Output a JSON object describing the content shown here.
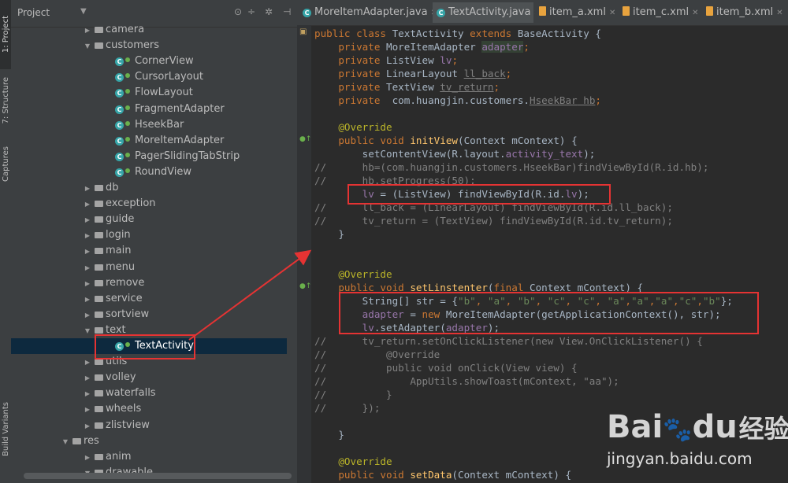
{
  "tool_window_strip": {
    "tabs": [
      "1: Project",
      "7: Structure",
      "Captures",
      "Build Variants"
    ]
  },
  "project_panel": {
    "title": "Project",
    "tree": [
      {
        "label": "camera",
        "kind": "folder",
        "depth": 1,
        "expanded": false
      },
      {
        "label": "customers",
        "kind": "folder",
        "depth": 1,
        "expanded": true
      },
      {
        "label": "CornerView",
        "kind": "class",
        "depth": 2
      },
      {
        "label": "CursorLayout",
        "kind": "class",
        "depth": 2
      },
      {
        "label": "FlowLayout",
        "kind": "class",
        "depth": 2
      },
      {
        "label": "FragmentAdapter",
        "kind": "class",
        "depth": 2
      },
      {
        "label": "HseekBar",
        "kind": "class",
        "depth": 2
      },
      {
        "label": "MoreItemAdapter",
        "kind": "class",
        "depth": 2
      },
      {
        "label": "PagerSlidingTabStrip",
        "kind": "class",
        "depth": 2
      },
      {
        "label": "RoundView",
        "kind": "class",
        "depth": 2
      },
      {
        "label": "db",
        "kind": "folder",
        "depth": 1,
        "expanded": false
      },
      {
        "label": "exception",
        "kind": "folder",
        "depth": 1,
        "expanded": false
      },
      {
        "label": "guide",
        "kind": "folder",
        "depth": 1,
        "expanded": false
      },
      {
        "label": "login",
        "kind": "folder",
        "depth": 1,
        "expanded": false
      },
      {
        "label": "main",
        "kind": "folder",
        "depth": 1,
        "expanded": false
      },
      {
        "label": "menu",
        "kind": "folder",
        "depth": 1,
        "expanded": false
      },
      {
        "label": "remove",
        "kind": "folder",
        "depth": 1,
        "expanded": false
      },
      {
        "label": "service",
        "kind": "folder",
        "depth": 1,
        "expanded": false
      },
      {
        "label": "sortview",
        "kind": "folder",
        "depth": 1,
        "expanded": false
      },
      {
        "label": "text",
        "kind": "folder",
        "depth": 1,
        "expanded": true
      },
      {
        "label": "TextActivity",
        "kind": "class",
        "depth": 2,
        "selected": true
      },
      {
        "label": "utils",
        "kind": "folder",
        "depth": 1,
        "expanded": false
      },
      {
        "label": "volley",
        "kind": "folder",
        "depth": 1,
        "expanded": false
      },
      {
        "label": "waterfalls",
        "kind": "folder",
        "depth": 1,
        "expanded": false
      },
      {
        "label": "wheels",
        "kind": "folder",
        "depth": 1,
        "expanded": false
      },
      {
        "label": "zlistview",
        "kind": "folder",
        "depth": 1,
        "expanded": false
      },
      {
        "label": "res",
        "kind": "folder",
        "depth": 0,
        "expanded": true
      },
      {
        "label": "anim",
        "kind": "folder",
        "depth": 1,
        "expanded": false
      },
      {
        "label": "drawable",
        "kind": "folder",
        "depth": 1,
        "expanded": true
      }
    ]
  },
  "editor_tabs": [
    {
      "label": "MoreItemAdapter.java",
      "type": "java",
      "active": false
    },
    {
      "label": "TextActivity.java",
      "type": "java",
      "active": true
    },
    {
      "label": "item_a.xml",
      "type": "xml",
      "active": false
    },
    {
      "label": "item_c.xml",
      "type": "xml",
      "active": false
    },
    {
      "label": "item_b.xml",
      "type": "xml",
      "active": false
    }
  ],
  "code_lines": [
    [
      [
        "kw",
        "public class "
      ],
      [
        "",
        "TextActivity "
      ],
      [
        "kw",
        "extends "
      ],
      [
        "",
        "BaseActivity {"
      ]
    ],
    [
      [
        "",
        "    "
      ],
      [
        "kw",
        "private "
      ],
      [
        "",
        "MoreItemAdapter "
      ],
      [
        "fld hl",
        "adapter"
      ],
      [
        "kw",
        ";"
      ]
    ],
    [
      [
        "",
        "    "
      ],
      [
        "kw",
        "private "
      ],
      [
        "",
        "ListView "
      ],
      [
        "fld",
        "lv"
      ],
      [
        "kw",
        ";"
      ]
    ],
    [
      [
        "",
        "    "
      ],
      [
        "kw",
        "private "
      ],
      [
        "",
        "LinearLayout "
      ],
      [
        "unused",
        "ll_back"
      ],
      [
        "kw",
        ";"
      ]
    ],
    [
      [
        "",
        "    "
      ],
      [
        "kw",
        "private "
      ],
      [
        "",
        "TextView "
      ],
      [
        "unused",
        "tv_return"
      ],
      [
        "kw",
        ";"
      ]
    ],
    [
      [
        "",
        "    "
      ],
      [
        "kw",
        "private  "
      ],
      [
        "",
        "com.huangjin.customers."
      ],
      [
        "unused",
        "HseekBar"
      ],
      [
        "",
        ""
      ],
      [
        "unused",
        " hb"
      ],
      [
        "kw",
        ";"
      ]
    ],
    [],
    [
      [
        "an",
        "    @Override"
      ]
    ],
    [
      [
        "",
        "    "
      ],
      [
        "kw",
        "public void "
      ],
      [
        "fn",
        "initView"
      ],
      [
        "",
        "(Context mContext) {"
      ]
    ],
    [
      [
        "",
        "        setContentView(R.layout."
      ],
      [
        "fld",
        "activity_text"
      ],
      [
        "",
        "); "
      ]
    ],
    [
      [
        "cm",
        "//      hb=(com.huangjin.customers.HseekBar)findViewById(R.id.hb);"
      ]
    ],
    [
      [
        "cm",
        "//      hb.setProgress(50);"
      ]
    ],
    [
      [
        "",
        "        "
      ],
      [
        "fld",
        "lv "
      ],
      [
        "",
        "= (ListView) findViewById(R.id."
      ],
      [
        "fld",
        "lv"
      ],
      [
        "",
        ");"
      ]
    ],
    [
      [
        "cm",
        "//      ll_back = (LinearLayout) findViewById(R.id.ll_back);"
      ]
    ],
    [
      [
        "cm",
        "//      tv_return = (TextView) findViewById(R.id.tv_return);"
      ]
    ],
    [
      [
        "",
        "    }"
      ]
    ],
    [],
    [],
    [
      [
        "an",
        "    @Override"
      ]
    ],
    [
      [
        "",
        "    "
      ],
      [
        "kw",
        "public void "
      ],
      [
        "fn",
        "setLinstenter"
      ],
      [
        "",
        "("
      ],
      [
        "kw",
        "final "
      ],
      [
        "",
        "Context mContext) {"
      ]
    ],
    [
      [
        "",
        "        String[] str = {"
      ],
      [
        "str",
        "\"b\""
      ],
      [
        "kw",
        ", "
      ],
      [
        "str",
        "\"a\""
      ],
      [
        "kw",
        ", "
      ],
      [
        "str",
        "\"b\""
      ],
      [
        "kw",
        ", "
      ],
      [
        "str",
        "\"c\""
      ],
      [
        "kw",
        ", "
      ],
      [
        "str",
        "\"c\""
      ],
      [
        "kw",
        ", "
      ],
      [
        "str",
        "\"a\""
      ],
      [
        "kw",
        ","
      ],
      [
        "str",
        "\"a\""
      ],
      [
        "kw",
        ","
      ],
      [
        "str",
        "\"a\""
      ],
      [
        "kw",
        ","
      ],
      [
        "str",
        "\"c\""
      ],
      [
        "kw",
        ","
      ],
      [
        "str",
        "\"b\""
      ],
      [
        "",
        "};"
      ]
    ],
    [
      [
        "",
        "        "
      ],
      [
        "fld",
        "adapter "
      ],
      [
        "",
        "= "
      ],
      [
        "kw",
        "new "
      ],
      [
        "",
        "MoreItemAdapter(getApplicationContext(), str);"
      ]
    ],
    [
      [
        "",
        "        "
      ],
      [
        "fld",
        "lv"
      ],
      [
        "",
        ".setAdapter("
      ],
      [
        "fld",
        "adapter"
      ],
      [
        "",
        ");"
      ]
    ],
    [
      [
        "cm",
        "//      tv_return.setOnClickListener(new View.OnClickListener() {"
      ]
    ],
    [
      [
        "cm",
        "//          @Override"
      ]
    ],
    [
      [
        "cm",
        "//          public void onClick(View view) {"
      ]
    ],
    [
      [
        "cm",
        "//              AppUtils.showToast(mContext, \"aa\");"
      ]
    ],
    [
      [
        "cm",
        "//          }"
      ]
    ],
    [
      [
        "cm",
        "//      });"
      ]
    ],
    [],
    [
      [
        "",
        "    }"
      ]
    ],
    [],
    [
      [
        "an",
        "    @Override"
      ]
    ],
    [
      [
        "",
        "    "
      ],
      [
        "kw",
        "public void "
      ],
      [
        "fn",
        "setData"
      ],
      [
        "",
        "(Context mContext) {"
      ]
    ]
  ],
  "watermark": {
    "logo_text": "Bai",
    "logo_text2": "du",
    "logo_zh": "经验",
    "url": "jingyan.baidu.com"
  },
  "colors": {
    "background": "#2b2b2b",
    "keyword": "#cc7832",
    "annotation": "#bbb529",
    "string": "#6a8759",
    "field": "#9876aa",
    "comment": "#808080",
    "highlight_box": "#e53333",
    "selection": "#0d293e"
  }
}
